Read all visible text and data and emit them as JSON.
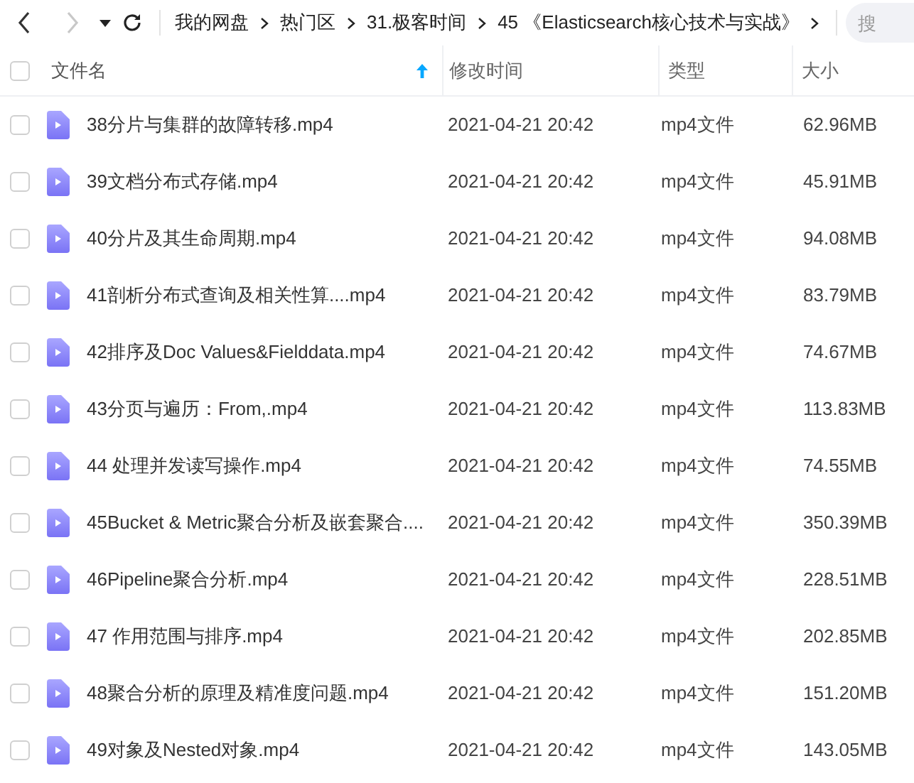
{
  "toolbar": {
    "back": {
      "disabled": false
    },
    "forward": {
      "disabled": true
    },
    "breadcrumbs": [
      {
        "label": "我的网盘"
      },
      {
        "label": "热门区"
      },
      {
        "label": "31.极客时间"
      },
      {
        "label": "45 《Elasticsearch核心技术与实战》"
      }
    ],
    "search": {
      "placeholder": "搜"
    }
  },
  "table": {
    "select_all": {
      "checked": false
    },
    "columns": [
      {
        "label": "文件名",
        "sorted": true
      },
      {
        "label": "修改时间",
        "sorted": false
      },
      {
        "label": "类型",
        "sorted": false
      },
      {
        "label": "大小",
        "sorted": false
      }
    ],
    "rows": [
      {
        "name": "38分片与集群的故障转移.mp4",
        "modified": "2021-04-21 20:42",
        "type": "mp4文件",
        "size": "62.96MB",
        "checked": false
      },
      {
        "name": "39文档分布式存储.mp4",
        "modified": "2021-04-21 20:42",
        "type": "mp4文件",
        "size": "45.91MB",
        "checked": false
      },
      {
        "name": "40分片及其生命周期.mp4",
        "modified": "2021-04-21 20:42",
        "type": "mp4文件",
        "size": "94.08MB",
        "checked": false
      },
      {
        "name": "41剖析分布式查询及相关性算....mp4",
        "modified": "2021-04-21 20:42",
        "type": "mp4文件",
        "size": "83.79MB",
        "checked": false
      },
      {
        "name": "42排序及Doc Values&Fielddata.mp4",
        "modified": "2021-04-21 20:42",
        "type": "mp4文件",
        "size": "74.67MB",
        "checked": false
      },
      {
        "name": "43分页与遍历：From,.mp4",
        "modified": "2021-04-21 20:42",
        "type": "mp4文件",
        "size": "113.83MB",
        "checked": false
      },
      {
        "name": "44 处理并发读写操作.mp4",
        "modified": "2021-04-21 20:42",
        "type": "mp4文件",
        "size": "74.55MB",
        "checked": false
      },
      {
        "name": "45Bucket & Metric聚合分析及嵌套聚合....",
        "modified": "2021-04-21 20:42",
        "type": "mp4文件",
        "size": "350.39MB",
        "checked": false
      },
      {
        "name": "46Pipeline聚合分析.mp4",
        "modified": "2021-04-21 20:42",
        "type": "mp4文件",
        "size": "228.51MB",
        "checked": false
      },
      {
        "name": "47 作用范围与排序.mp4",
        "modified": "2021-04-21 20:42",
        "type": "mp4文件",
        "size": "202.85MB",
        "checked": false
      },
      {
        "name": "48聚合分析的原理及精准度问题.mp4",
        "modified": "2021-04-21 20:42",
        "type": "mp4文件",
        "size": "151.20MB",
        "checked": false
      },
      {
        "name": "49对象及Nested对象.mp4",
        "modified": "2021-04-21 20:42",
        "type": "mp4文件",
        "size": "143.05MB",
        "checked": false
      }
    ]
  }
}
